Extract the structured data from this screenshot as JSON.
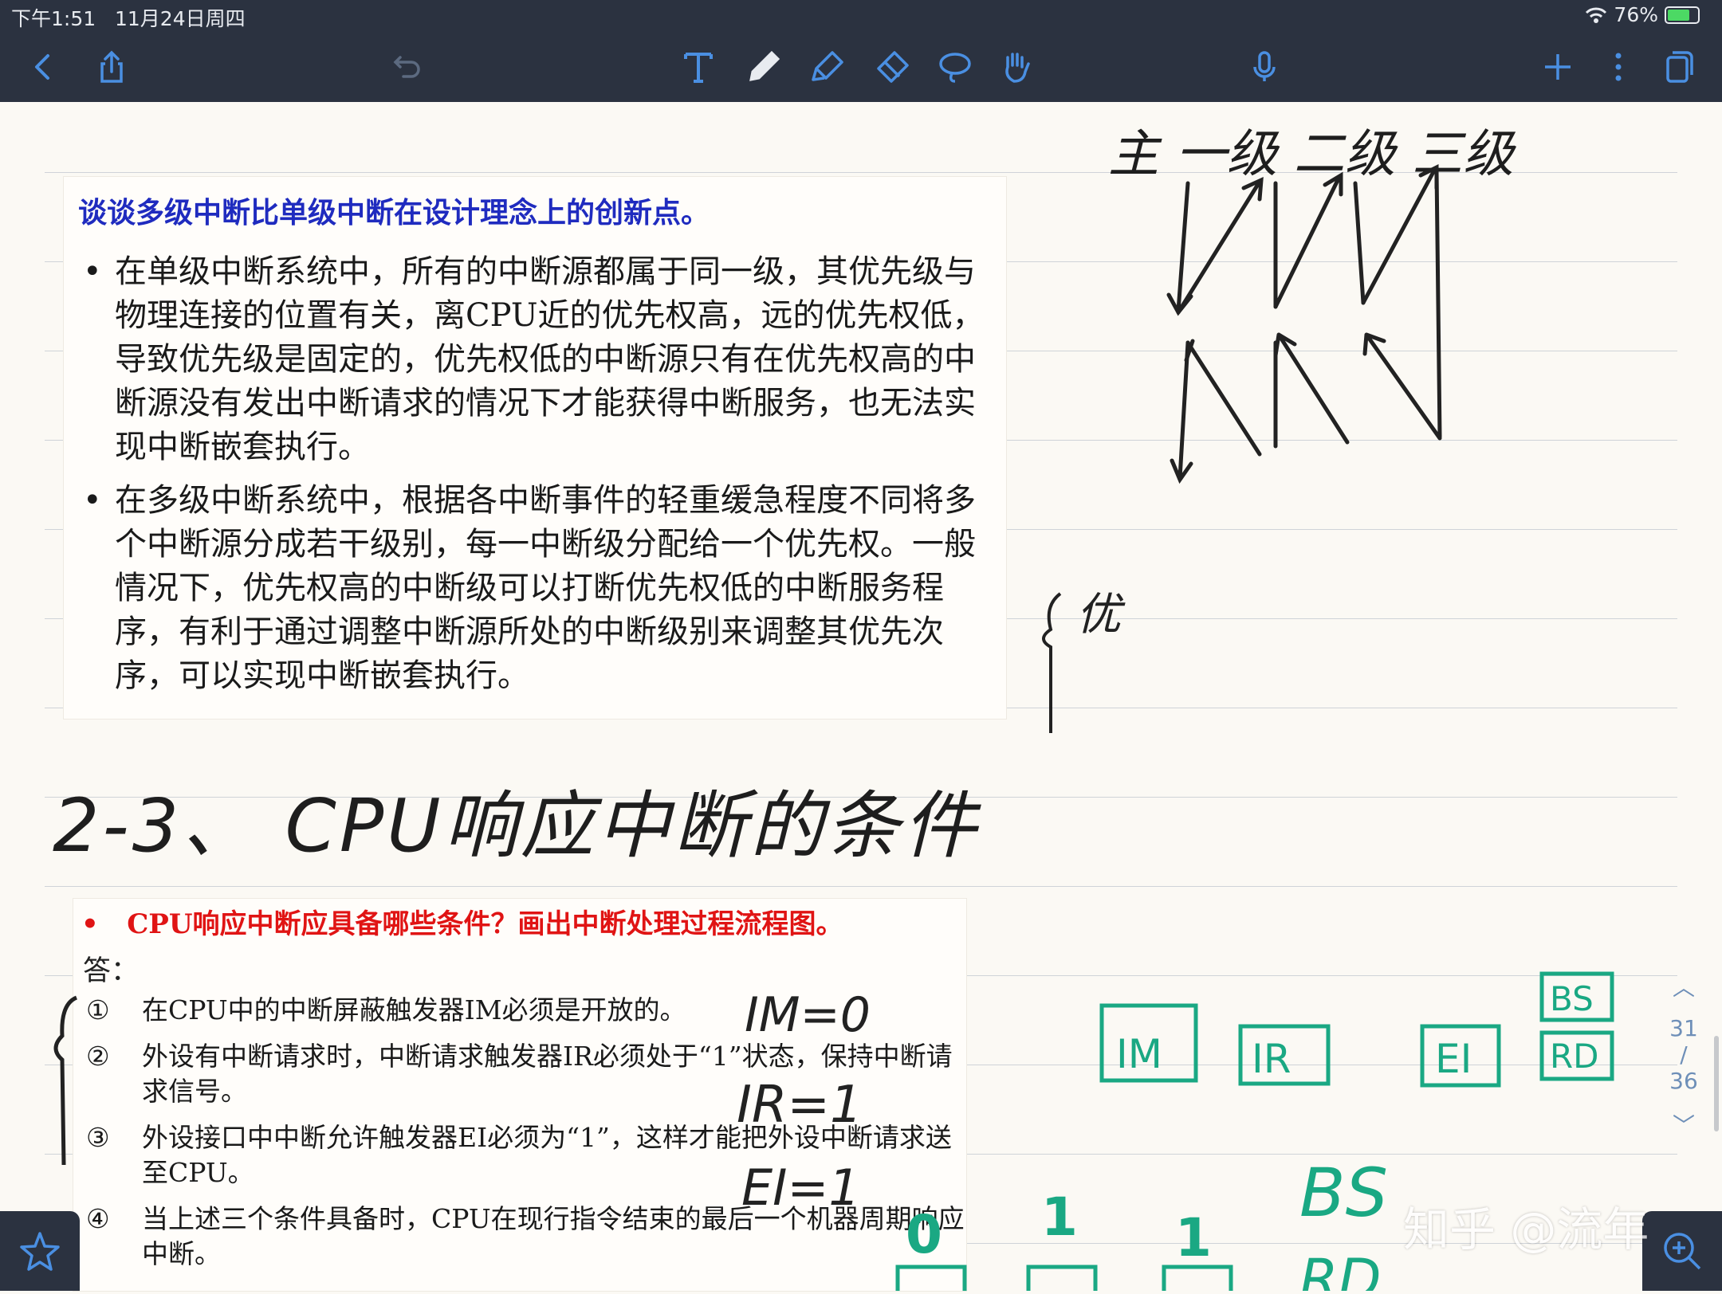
{
  "status": {
    "time": "下午1:51",
    "date": "11月24日周四",
    "battery": "76%",
    "battery_level": 0.76
  },
  "toolbar": {
    "back": "back-icon",
    "share": "share-icon",
    "undo": "undo-icon",
    "tools": [
      "text-tool-icon",
      "pen-icon",
      "highlighter-icon",
      "eraser-icon",
      "lasso-icon",
      "hand-icon"
    ],
    "mic": "microphone-icon",
    "add": "plus-icon",
    "more": "more-icon",
    "pages": "pages-icon"
  },
  "slide1": {
    "question": "谈谈多级中断比单级中断在设计理念上的创新点。",
    "bullets": [
      "在单级中断系统中，所有的中断源都属于同一级，其优先级与物理连接的位置有关，离CPU近的优先权高，远的优先权低，导致优先级是固定的，优先权低的中断源只有在优先权高的中断源没有发出中断请求的情况下才能获得中断服务，也无法实现中断嵌套执行。",
      "在多级中断系统中，根据各中断事件的轻重缓急程度不同将多个中断源分成若干级别，每一中断级分配给一个优先权。一般情况下，优先权高的中断级可以打断优先权低的中断服务程序，有利于通过调整中断源所处的中断级别来调整其优先次序，可以实现中断嵌套执行。"
    ]
  },
  "handwriting": {
    "levels": "主  一级 二级 三级",
    "you": "优",
    "heading": "2-3、 CPU响应中断的条件",
    "im": "IM=0",
    "ir": "IR=1",
    "ei": "EI=1",
    "boxes": [
      "IM",
      "IR",
      "EI",
      "BS",
      "RD"
    ],
    "bs": "BS",
    "rd": "RD",
    "zero": "0",
    "one1": "1",
    "one2": "1"
  },
  "slide2": {
    "question": "CPU响应中断应具备哪些条件？画出中断处理过程流程图。",
    "answer_label": "答：",
    "items": [
      {
        "num": "①",
        "text": "在CPU中的中断屏蔽触发器IM必须是开放的。"
      },
      {
        "num": "②",
        "text": "外设有中断请求时，中断请求触发器IR必须处于“1”状态，保持中断请求信号。"
      },
      {
        "num": "③",
        "text": "外设接口中中断允许触发器EI必须为“1”，这样才能把外设中断请求送至CPU。"
      },
      {
        "num": "④",
        "text": "当上述三个条件具备时，CPU在现行指令结束的最后一个机器周期响应中断。"
      }
    ]
  },
  "pagination": {
    "current": "31",
    "separator": "/",
    "total": "36"
  },
  "watermark": "知乎 @流年",
  "colors": {
    "toolbar": "#2b3240",
    "accent": "#4a8fe2",
    "green_ink": "#1aa883",
    "question_blue": "#1f2bbf",
    "question_red": "#e01414"
  }
}
